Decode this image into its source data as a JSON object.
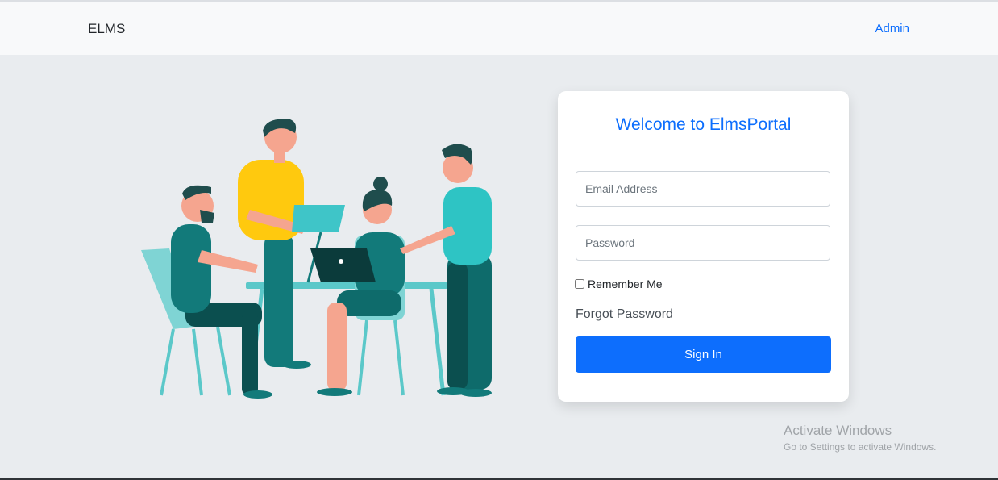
{
  "navbar": {
    "brand": "ELMS",
    "admin_link": "Admin"
  },
  "login": {
    "title": "Welcome to ElmsPortal",
    "email_placeholder": "Email Address",
    "email_value": "",
    "password_placeholder": "Password",
    "password_value": "",
    "remember_label": "Remember Me",
    "remember_checked": false,
    "forgot_link": "Forgot Password",
    "signin_label": "Sign In"
  },
  "watermark": {
    "title": "Activate Windows",
    "subtitle": "Go to Settings to activate Windows."
  },
  "colors": {
    "accent": "#0d6efd",
    "teal": "#0e6b6b",
    "teal_light": "#2ec4c4",
    "yellow": "#ffc90e",
    "skin": "#f5a58f",
    "hair": "#1f4d4d"
  }
}
